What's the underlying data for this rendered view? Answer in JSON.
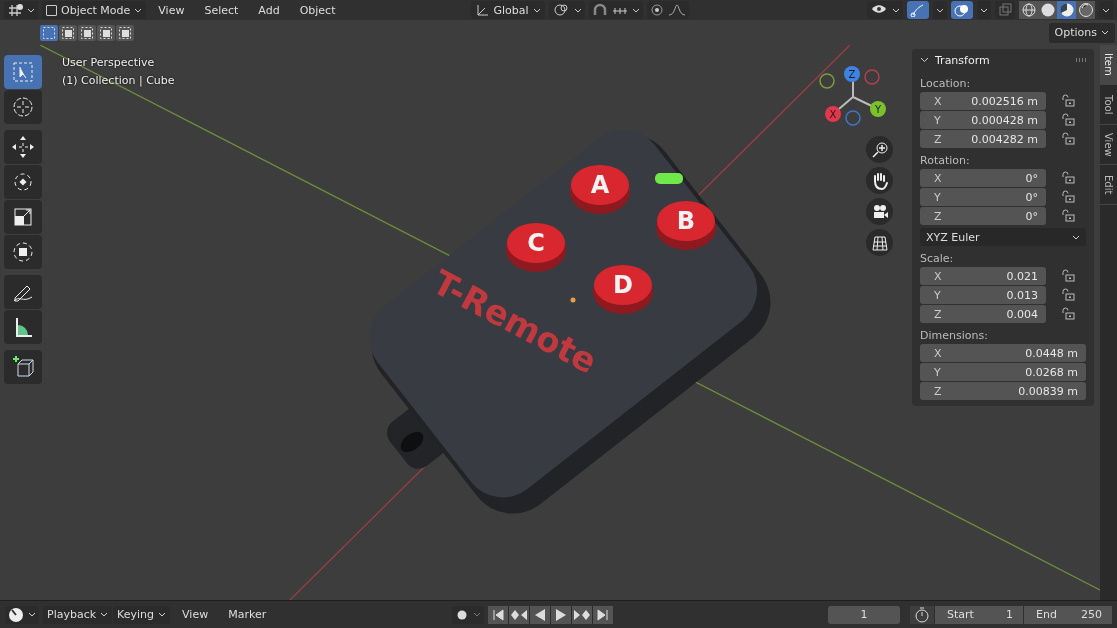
{
  "header": {
    "mode": "Object Mode",
    "menus": [
      "View",
      "Select",
      "Add",
      "Object"
    ],
    "orientation": "Global"
  },
  "select_modes": [
    {
      "selected": true
    },
    {
      "selected": false
    },
    {
      "selected": false
    },
    {
      "selected": false
    },
    {
      "selected": false
    }
  ],
  "shading_modes": [
    {
      "kind": "wireframe",
      "selected": false
    },
    {
      "kind": "solid",
      "selected": false
    },
    {
      "kind": "material",
      "selected": true
    },
    {
      "kind": "rendered",
      "selected": false
    }
  ],
  "options_label": "Options",
  "viewport": {
    "perspective": "User Perspective",
    "collection": "(1) Collection | Cube"
  },
  "tools": [
    {
      "kind": "select",
      "selected": true
    },
    {
      "kind": "cursor",
      "selected": false
    },
    {
      "kind": "move",
      "selected": false
    },
    {
      "kind": "rotate",
      "selected": false
    },
    {
      "kind": "scale",
      "selected": false
    },
    {
      "kind": "transform",
      "selected": false
    },
    {
      "kind": "annotate",
      "selected": false
    },
    {
      "kind": "measure",
      "selected": false
    },
    {
      "kind": "add_cube",
      "selected": false
    }
  ],
  "gizmo": {
    "x": "X",
    "y": "Y",
    "z": "Z"
  },
  "model": {
    "buttons": [
      "A",
      "B",
      "C",
      "D"
    ],
    "logo": "T-Remote"
  },
  "transform_panel": {
    "title": "Transform",
    "sections": [
      {
        "label": "Location:",
        "locks": true,
        "rows": [
          {
            "axis": "X",
            "value": "0.002516 m"
          },
          {
            "axis": "Y",
            "value": "0.000428 m"
          },
          {
            "axis": "Z",
            "value": "0.004282 m"
          }
        ]
      },
      {
        "label": "Rotation:",
        "locks": true,
        "rows": [
          {
            "axis": "X",
            "value": "0°"
          },
          {
            "axis": "Y",
            "value": "0°"
          },
          {
            "axis": "Z",
            "value": "0°"
          }
        ],
        "mode": "XYZ Euler"
      },
      {
        "label": "Scale:",
        "locks": true,
        "rows": [
          {
            "axis": "X",
            "value": "0.021"
          },
          {
            "axis": "Y",
            "value": "0.013"
          },
          {
            "axis": "Z",
            "value": "0.004"
          }
        ]
      },
      {
        "label": "Dimensions:",
        "locks": false,
        "rows": [
          {
            "axis": "X",
            "value": "0.0448 m"
          },
          {
            "axis": "Y",
            "value": "0.0268 m"
          },
          {
            "axis": "Z",
            "value": "0.00839 m"
          }
        ]
      }
    ]
  },
  "side_tabs": [
    {
      "label": "Item",
      "selected": true
    },
    {
      "label": "Tool",
      "selected": false
    },
    {
      "label": "View",
      "selected": false
    },
    {
      "label": "Edit",
      "selected": false
    }
  ],
  "timeline": {
    "dropdown_menus": [
      "Playback",
      "Keying"
    ],
    "menus": [
      "View",
      "Marker"
    ],
    "current_frame": "1",
    "start_label": "Start",
    "start": "1",
    "end_label": "End",
    "end": "250"
  }
}
